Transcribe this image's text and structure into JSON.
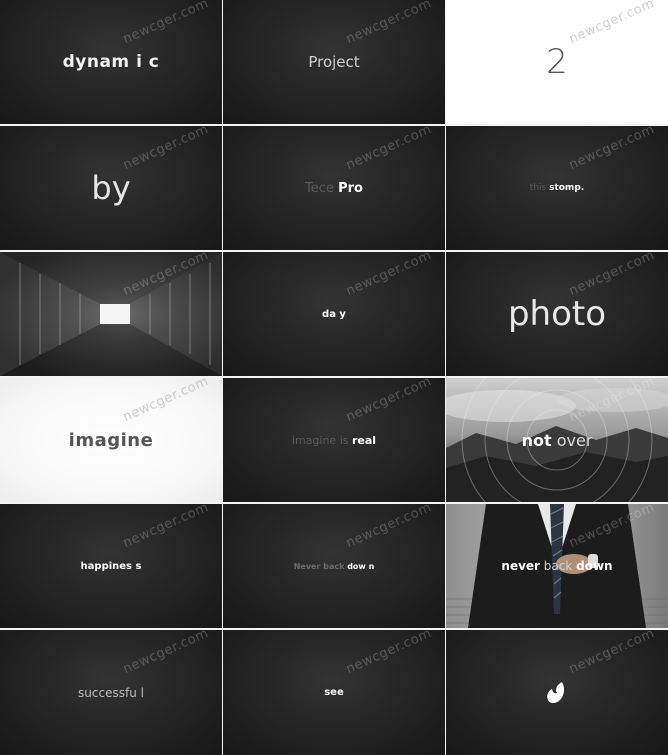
{
  "watermark": "newcger.com",
  "cells": {
    "c1": {
      "text": "dynam i  c"
    },
    "c2": {
      "text": "Project"
    },
    "c3": {
      "text": "2"
    },
    "c4": {
      "text": "by"
    },
    "c5": {
      "dim": "Tece ",
      "bright": "Pro"
    },
    "c6": {
      "dim": "this ",
      "bright": "stomp."
    },
    "c8": {
      "text": "da y"
    },
    "c9": {
      "text": "photo"
    },
    "c10": {
      "text": "imagine"
    },
    "c11": {
      "dim": "imagine is ",
      "bright": "real"
    },
    "c12": {
      "bright": "not",
      "dim": " over"
    },
    "c13": {
      "text": "happines s"
    },
    "c14": {
      "dim": "Never back ",
      "bright": "dow n"
    },
    "c15": {
      "bright1": "never",
      "dim": " back ",
      "bright2": "down"
    },
    "c16": {
      "text": "successfu l"
    },
    "c17": {
      "text": "see"
    }
  },
  "icons": {
    "c7": "architecture-photo",
    "c12": "landscape-photo",
    "c15": "businessman-photo",
    "c18": "envato-logo-icon"
  }
}
